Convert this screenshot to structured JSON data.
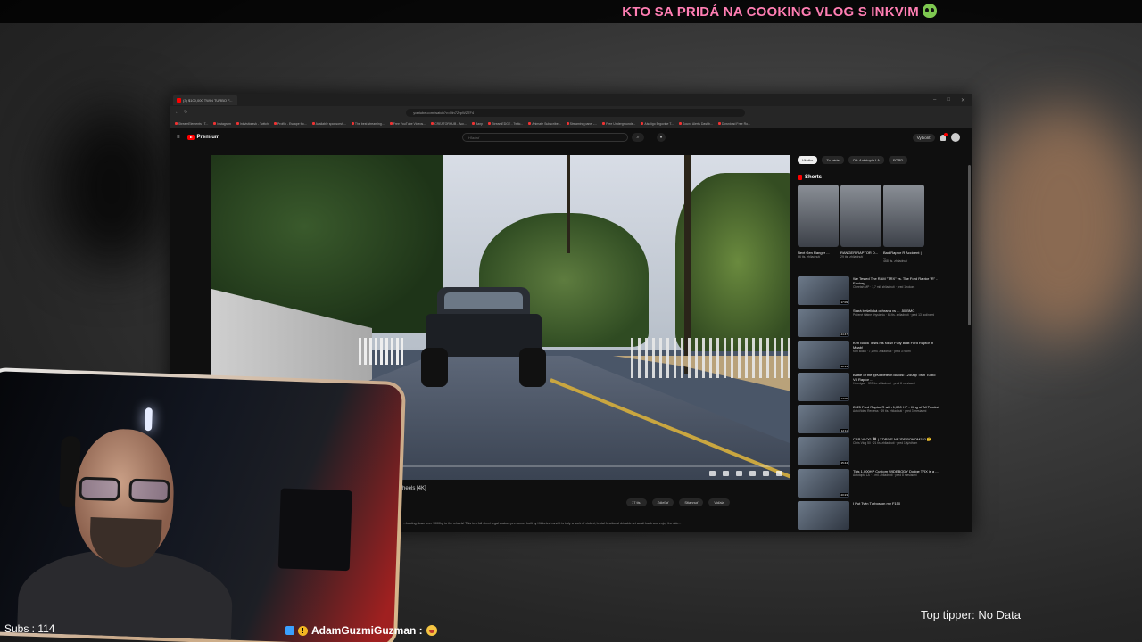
{
  "overlay": {
    "banner_text": "KTO SA PRIDÁ NA COOKING VLOG S INKVIM",
    "subs_text": "Subs : 114",
    "top_tipper_text": "Top tipper: No Data",
    "alert_user": "AdamGuzmiGuzman :"
  },
  "browser": {
    "tab_title": "(3) $100,000 TWIN TURBO F...",
    "url": "youtube.com/watch?v=Mn7ZrpWZ7F4",
    "bookmarks": [
      "StreamElements | T...",
      "Instagram",
      "Inkvisitorsvk - Twitch",
      "Profilu - Escape fro...",
      "Available sponsorsh...",
      "The best streaming...",
      "Free YouTube Videos...",
      "CREATORHUB - Acc...",
      "Banp",
      "StreamEDGE - Twitc...",
      "Animate Subscribe...",
      "Streaming panel -...",
      "Free Undergrounds...",
      "Alsoligo Ergovine T...",
      "Sound Alerts Dashb...",
      "Download Free Ro..."
    ]
  },
  "youtube": {
    "logo_text": "Premium",
    "search_placeholder": "Hľadať",
    "create_label": "Vytvoriť",
    "video_title": "...heels [4K]",
    "actions": [
      "17 tis.",
      "Zdieľať",
      "Stiahnuť",
      "Viďala"
    ],
    "description": "...busting down over 1000hp to the wheels! This is a full street legal custom pre-runner built by Kibbetech and it is truly a work of violent, brutal functional drivable art as sit back and enjoy the ride...",
    "chips": [
      "Všetko",
      "Zo série",
      "Od: Autotopia LA",
      "FORD"
    ],
    "shorts_heading": "Shorts",
    "shorts": [
      {
        "title": "Next Gen Ranger ...",
        "views": "66 tis. zhliadnutí"
      },
      {
        "title": "RANGER RAPTOR D...",
        "views": "29 tis. zhliadnutí"
      },
      {
        "title": "Bad Raptor R Accident | ...",
        "views": "468 tis. zhliadnutí"
      }
    ],
    "recommendations": [
      {
        "title": "We Tested The RAM \"TRX\" vs. The Ford Raptor \"R\" - Factory ...",
        "meta": "Cheetah MP · 1,7 mil. zhliadnutí · pred 1 rokom",
        "duration": "17:09"
      },
      {
        "title": "Stará bešelická ochrana vs ... .50 BMG",
        "meta": "Pečené štátne chystaniu · 63 tis. zhliadnutí · pred 13 hodinami",
        "duration": "24:47"
      },
      {
        "title": "Ken Block Tests his NEW Fully Built Ford Raptor in Moab!",
        "meta": "Ken Block · 7,1 mil. zhliadnutí · pred 3 rokmi",
        "duration": "18:33"
      },
      {
        "title": "Battle of the @Kibbetech Builds! 1250hp Twin Turbo V8 Raptor ...",
        "meta": "Hoonigan · 399 tis. zhliadnutí · pred 8 mesiacmi",
        "duration": "17:09"
      },
      {
        "title": "2025 Ford Raptor R with 1,000 HP - King of All Trucks!",
        "meta": "AutoVideo Reviews · 69 tis. zhliadnutí · pred 3 mesiacmi",
        "duration": "12:11"
      },
      {
        "title": "CAR VLOG 🏁 | XDRIVE NEJDE BOKOM??? 🤔",
        "meta": "Chris Vlog 50 · 21 tis. zhliadnutí · pred 1 týždňom",
        "duration": "15:44"
      },
      {
        "title": "This 1,000HP Custom WIDEBODY Dodge TRX is a ...",
        "meta": "Autotopia LA · 1 mil. zhliadnutí · pred 8 mesiacmi",
        "duration": "20:23"
      },
      {
        "title": "I Put Twin Turbos on my F150",
        "meta": "",
        "duration": ""
      }
    ]
  },
  "colors": {
    "banner": "#ff7eb3",
    "yt_red": "#ff0000",
    "cam_frame": "#d9b88a"
  }
}
